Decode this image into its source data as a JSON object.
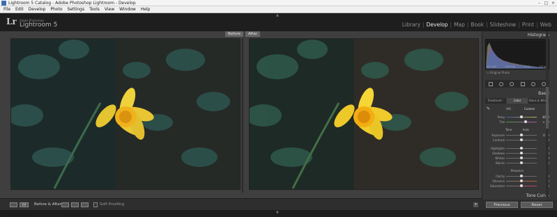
{
  "window": {
    "title": "Lightroom 5 Catalog - Adobe Photoshop Lightroom - Develop",
    "controls": [
      "–",
      "□",
      "×"
    ]
  },
  "menu": [
    "File",
    "Edit",
    "Develop",
    "Photo",
    "Settings",
    "Tools",
    "View",
    "Window",
    "Help"
  ],
  "header": {
    "logo": "Lr",
    "sub1": "Adobe Photoshop",
    "sub2": "Lightroom 5",
    "modules": [
      "Library",
      "Develop",
      "Map",
      "Book",
      "Slideshow",
      "Print",
      "Web"
    ],
    "active_module": "Develop"
  },
  "view": {
    "before_label": "Before",
    "after_label": "After"
  },
  "toolbar": {
    "before_after_label": "Before & After :",
    "soft_proofing_label": "Soft Proofing",
    "yy": "Y|Y"
  },
  "panel": {
    "histogram_title": "Histogram",
    "histogram_values": [
      "ISO 100",
      "250 mm",
      "f / 11",
      "1/5 sec"
    ],
    "original_photo": "Original Photo",
    "basic_title": "Basic",
    "treatment_label": "Treatment :",
    "color_label": "Color",
    "bw_label": "Black & White",
    "wb_label": "WB :",
    "wb_value": "Custom",
    "temp_label": "Temp",
    "temp_value": "4650",
    "tint_label": "Tint",
    "tint_value": "+ 22",
    "tone_label": "Tone",
    "auto_label": "Auto",
    "exposure_label": "Exposure",
    "exposure_value": "0.00",
    "contrast_label": "Contrast",
    "contrast_value": "0",
    "highlights_label": "Highlights",
    "highlights_value": "0",
    "shadows_label": "Shadows",
    "shadows_value": "0",
    "whites_label": "Whites",
    "whites_value": "0",
    "blacks_label": "Blacks",
    "blacks_value": "0",
    "presence_label": "Presence",
    "clarity_label": "Clarity",
    "clarity_value": "0",
    "vibrance_label": "Vibrance",
    "vibrance_value": "0",
    "saturation_label": "Saturation",
    "saturation_value": "0",
    "tone_curve_title": "Tone Curve",
    "previous_button": "Previous",
    "reset_button": "Reset"
  }
}
